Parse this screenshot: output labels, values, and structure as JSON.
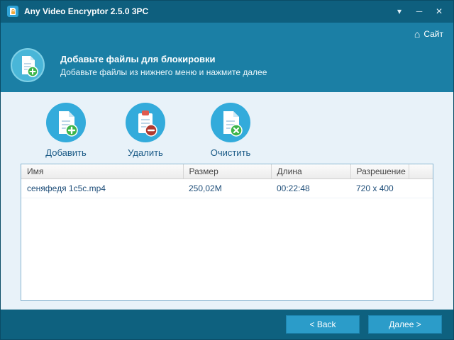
{
  "window": {
    "title": "Any Video Encryptor 2.5.0 3PC",
    "controls": {
      "menu": "▾",
      "minimize": "─",
      "close": "✕"
    }
  },
  "topbar": {
    "site_label": "Сайт",
    "home_glyph": "⌂"
  },
  "header": {
    "title": "Добавьте файлы для блокировки",
    "subtitle": "Добавьте файлы из нижнего меню и нажмите далее"
  },
  "toolbar": {
    "add_label": "Добавить",
    "remove_label": "Удалить",
    "clear_label": "Очистить"
  },
  "table": {
    "columns": [
      "Имя",
      "Размер",
      "Длина",
      "Разрешение"
    ],
    "rows": [
      [
        "сеняфедя 1с5с.mp4",
        "250,02M",
        "00:22:48",
        "720 x 400"
      ]
    ]
  },
  "footer": {
    "back_label": "< Back",
    "next_label": "Далее >"
  },
  "colors": {
    "titlebar": "#0e5f7e",
    "band": "#1b7fa5",
    "accent_blue": "#33abdb",
    "badge_green": "#3cb54a",
    "badge_red": "#c0392b",
    "button": "#2b9cc9"
  }
}
